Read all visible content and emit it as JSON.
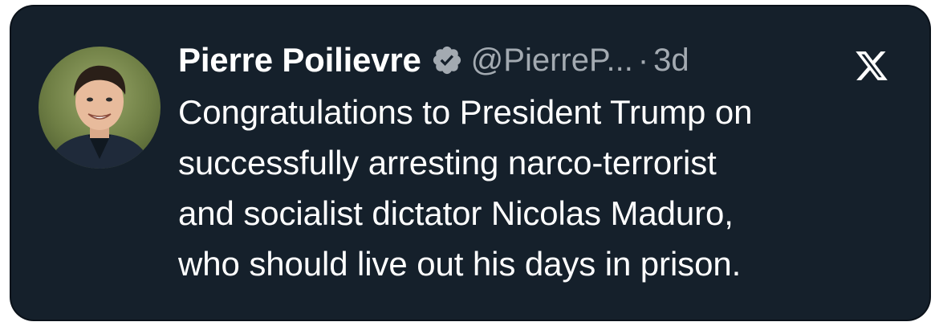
{
  "tweet": {
    "author_name": "Pierre Poilievre",
    "handle": "@PierreP...",
    "separator": "·",
    "time_ago": "3d",
    "text": "Congratulations to President Trump on\nsuccessfully arresting narco-terrorist\nand socialist dictator Nicolas Maduro,\nwho should live out his days in prison.",
    "verified": true,
    "icons": {
      "verified": "verified-badge-icon",
      "platform": "x-logo-icon"
    }
  },
  "colors": {
    "card_background": "#15202b",
    "text_primary": "#ffffff",
    "text_secondary": "#a3aab1"
  }
}
